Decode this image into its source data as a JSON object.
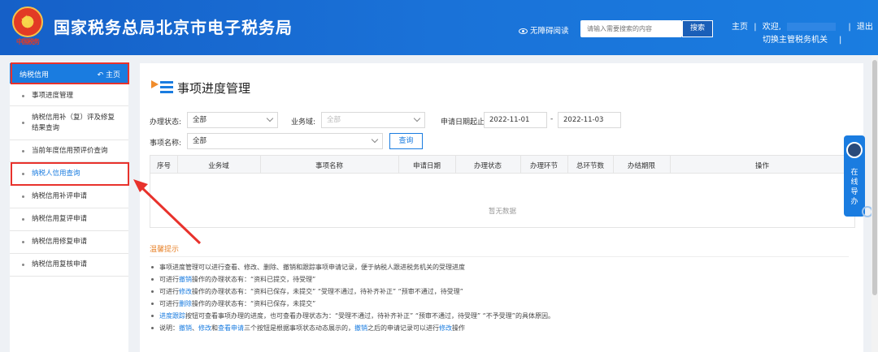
{
  "header": {
    "site_title": "国家税务总局北京市电子税务局",
    "emblem_text": "中国税务",
    "accessibility": "无障碍阅读",
    "search_placeholder": "请输入需要搜索的内容",
    "search_button": "搜索",
    "home": "主页",
    "welcome": "欢迎,",
    "logout": "退出",
    "switch_authority": "切换主管税务机关",
    "separator": "|"
  },
  "sidebar": {
    "title": "纳税信用",
    "home_link": "主页",
    "items": [
      {
        "label": "事项进度管理"
      },
      {
        "label": "纳税信用补（复）评及修复结果查询"
      },
      {
        "label": "当前年度信用预评价查询"
      },
      {
        "label": "纳税人信用查询"
      },
      {
        "label": "纳税信用补评申请"
      },
      {
        "label": "纳税信用复评申请"
      },
      {
        "label": "纳税信用修复申请"
      },
      {
        "label": "纳税信用复核申请"
      }
    ]
  },
  "main": {
    "page_title": "事项进度管理",
    "form": {
      "status_label": "办理状态:",
      "status_value": "全部",
      "domain_label": "业务域:",
      "domain_value": "全部",
      "date_label": "申请日期起止:",
      "date_from": "2022-11-01",
      "date_sep": "-",
      "date_to": "2022-11-03",
      "item_label": "事项名称:",
      "item_value": "全部",
      "query_button": "查询"
    },
    "table": {
      "columns": [
        "序号",
        "业务域",
        "事项名称",
        "申请日期",
        "办理状态",
        "办理环节",
        "总环节数",
        "办结期限",
        "操作"
      ],
      "empty_text": "暂无数据"
    },
    "tips": {
      "title": "温馨提示",
      "lines": [
        {
          "parts": [
            {
              "t": "事项进度管理可以进行查看、修改、删除、撤销和跟踪事项申请记录，便于纳税人跟进税务机关的受理进度",
              "link": false
            }
          ]
        },
        {
          "parts": [
            {
              "t": "可进行",
              "link": false
            },
            {
              "t": "撤销",
              "link": true
            },
            {
              "t": "操作的办理状态有：“资料已提交，待受理”",
              "link": false
            }
          ]
        },
        {
          "parts": [
            {
              "t": "可进行",
              "link": false
            },
            {
              "t": "修改",
              "link": true
            },
            {
              "t": "操作的办理状态有：“资料已保存，未提交”  “受理不通过，待补齐补正”  “预审不通过，待受理”",
              "link": false
            }
          ]
        },
        {
          "parts": [
            {
              "t": "可进行",
              "link": false
            },
            {
              "t": "删除",
              "link": true
            },
            {
              "t": "操作的办理状态有：“资料已保存，未提交”",
              "link": false
            }
          ]
        },
        {
          "parts": [
            {
              "t": "进度跟踪",
              "link": true
            },
            {
              "t": "按钮可查看事项办理的进度，也可查看办理状态为：“受理不通过，待补齐补正”  “预审不通过，待受理”  “不予受理”的具体原因。",
              "link": false
            }
          ]
        },
        {
          "parts": [
            {
              "t": "说明：",
              "link": false
            },
            {
              "t": "撤销",
              "link": true
            },
            {
              "t": "、",
              "link": false
            },
            {
              "t": "修改",
              "link": true
            },
            {
              "t": "和",
              "link": false
            },
            {
              "t": "查看申请",
              "link": true
            },
            {
              "t": "三个按钮是根据事项状态动态展示的，",
              "link": false
            },
            {
              "t": "撤销",
              "link": true
            },
            {
              "t": "之后的申请记录可以进行",
              "link": false
            },
            {
              "t": "修改",
              "link": true
            },
            {
              "t": "操作",
              "link": false
            }
          ]
        }
      ]
    }
  },
  "float_help": {
    "text": "在线导办"
  },
  "colors": {
    "brand": "#1a7ce0",
    "annotation": "#e8322c",
    "tip_title": "#e8842c"
  }
}
